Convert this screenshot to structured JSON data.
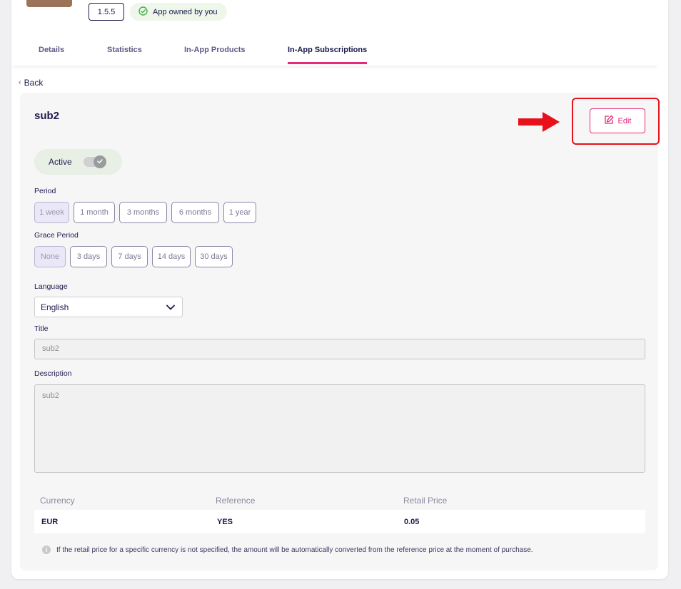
{
  "header": {
    "version": "1.5.5",
    "owned_label": "App owned by you"
  },
  "tabs": [
    {
      "label": "Details"
    },
    {
      "label": "Statistics"
    },
    {
      "label": "In-App Products"
    },
    {
      "label": "In-App Subscriptions"
    }
  ],
  "active_tab": "In-App Subscriptions",
  "back_label": "Back",
  "subscription": {
    "name": "sub2",
    "edit_label": "Edit",
    "status_label": "Active",
    "active": true
  },
  "period": {
    "label": "Period",
    "options": [
      "1 week",
      "1 month",
      "3 months",
      "6 months",
      "1 year"
    ],
    "selected": "1 week"
  },
  "grace_period": {
    "label": "Grace Period",
    "options": [
      "None",
      "3 days",
      "7 days",
      "14 days",
      "30 days"
    ],
    "selected": "None"
  },
  "language": {
    "label": "Language",
    "value": "English"
  },
  "title_field": {
    "label": "Title",
    "value": "sub2"
  },
  "description_field": {
    "label": "Description",
    "value": "sub2"
  },
  "pricing_table": {
    "headers": [
      "Currency",
      "Reference",
      "Retail Price"
    ],
    "rows": [
      {
        "currency": "EUR",
        "reference": "YES",
        "retail_price": "0.05"
      }
    ]
  },
  "footnote": "If the retail price for a specific currency is not specified, the amount will be automatically converted from the reference price at the moment of purchase.",
  "colors": {
    "accent": "#e5287a",
    "navy": "#1e1a4d",
    "highlight_red": "#e8101b",
    "owned_green": "#4caf50"
  }
}
